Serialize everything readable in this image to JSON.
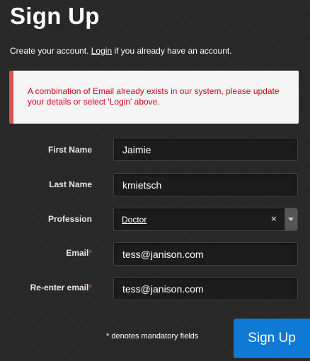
{
  "header": {
    "title": "Sign Up",
    "subtitle_prefix": "Create your account.",
    "login_link": "Login",
    "subtitle_suffix": "if you already have an account."
  },
  "alert": {
    "message": "A combination of Email already exists in our system, please update your details or select 'Login' above."
  },
  "form": {
    "first_name": {
      "label": "First Name",
      "value": "Jaimie"
    },
    "last_name": {
      "label": "Last Name",
      "value": "kmietsch"
    },
    "profession": {
      "label": "Profession",
      "value": "Doctor",
      "clear": "×"
    },
    "email": {
      "label": "Email",
      "required_mark": "*",
      "value": "tess@janison.com"
    },
    "reenter_email": {
      "label": "Re-enter email",
      "required_mark": "*",
      "value": "tess@janison.com"
    }
  },
  "footer": {
    "mandatory_note": "* denotes mandatory fields",
    "signup_button": "Sign Up"
  },
  "colors": {
    "accent": "#0f7ad6",
    "error": "#d0021b",
    "alert_border": "#d9534f"
  }
}
